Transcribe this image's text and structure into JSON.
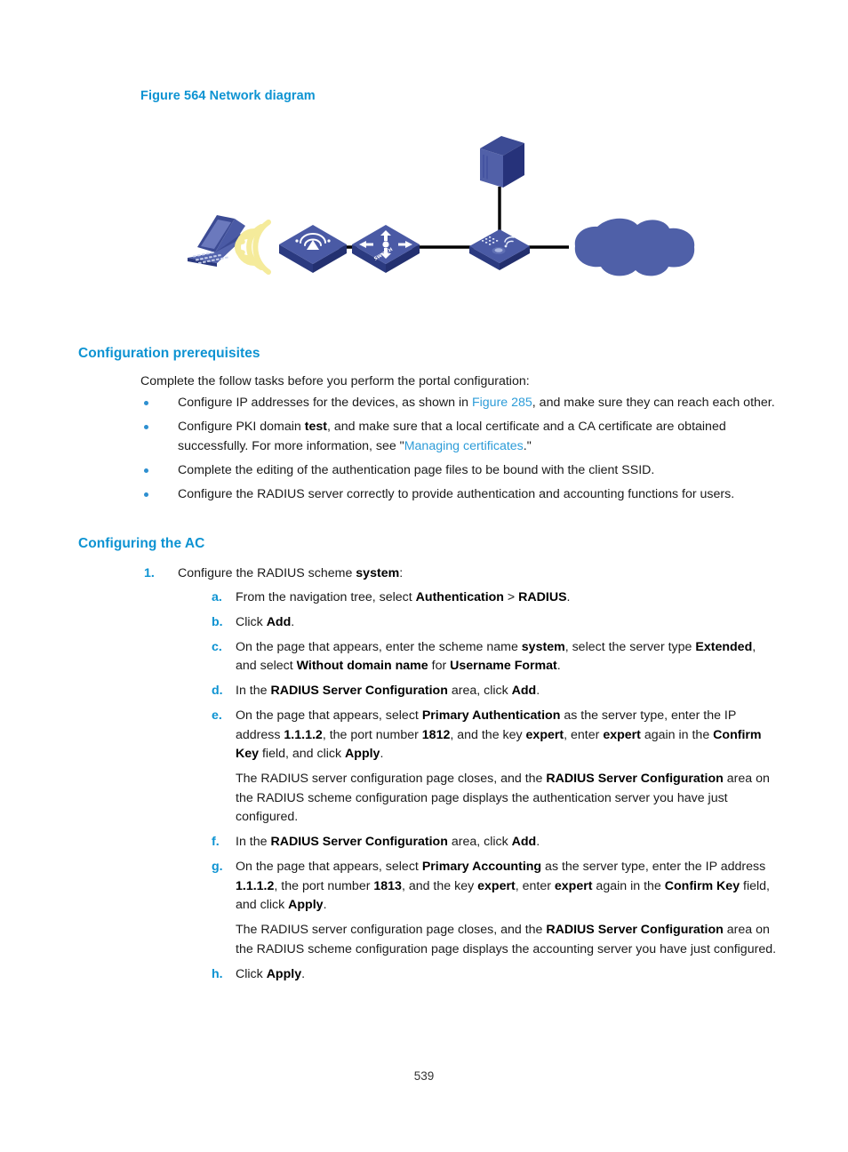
{
  "figure": {
    "caption": "Figure 564 Network diagram",
    "nodes": [
      {
        "id": "client",
        "icon": "laptop-icon",
        "label": ""
      },
      {
        "id": "wireless-signal",
        "icon": "wireless-waves-icon",
        "label": ""
      },
      {
        "id": "ap",
        "icon": "access-point-icon",
        "label": ""
      },
      {
        "id": "switch",
        "icon": "switch-icon",
        "label": "SWITCH"
      },
      {
        "id": "ac",
        "icon": "access-controller-icon",
        "label": ""
      },
      {
        "id": "server",
        "icon": "server-icon",
        "label": ""
      },
      {
        "id": "network-cloud",
        "icon": "cloud-icon",
        "label": ""
      }
    ],
    "colors": {
      "device_dark": "#2b3a80",
      "device_mid": "#3d4f96",
      "device_light": "#5b6cb0",
      "cloud": "#4f60a8",
      "signal": "#f5ea9a",
      "link": "#000000",
      "laptop_screen": "#6b79bd"
    }
  },
  "sections": {
    "prerequisites": {
      "heading": "Configuration prerequisites",
      "intro": "Complete the follow tasks before you perform the portal configuration:",
      "bullets": [
        {
          "parts": [
            {
              "t": "Configure IP addresses for the devices, as shown in ",
              "s": "normal"
            },
            {
              "t": "Figure 285",
              "s": "link"
            },
            {
              "t": ", and make sure they can reach each other.",
              "s": "normal"
            }
          ]
        },
        {
          "parts": [
            {
              "t": "Configure PKI domain ",
              "s": "normal"
            },
            {
              "t": "test",
              "s": "bold"
            },
            {
              "t": ", and make sure that a local certificate and a CA certificate are obtained successfully. For more information, see \"",
              "s": "normal"
            },
            {
              "t": "Managing certificates",
              "s": "link"
            },
            {
              "t": ".\"",
              "s": "normal"
            }
          ]
        },
        {
          "parts": [
            {
              "t": "Complete the editing of the authentication page files to be bound with the client SSID.",
              "s": "normal"
            }
          ]
        },
        {
          "parts": [
            {
              "t": "Configure the RADIUS server correctly to provide authentication and accounting functions for users.",
              "s": "normal"
            }
          ]
        }
      ]
    },
    "configuring_ac": {
      "heading": "Configuring the AC",
      "steps": [
        {
          "marker": "1.",
          "parts": [
            {
              "t": "Configure the RADIUS scheme ",
              "s": "normal"
            },
            {
              "t": "system",
              "s": "bold"
            },
            {
              "t": ":",
              "s": "normal"
            }
          ],
          "substeps": [
            {
              "marker": "a.",
              "parts": [
                {
                  "t": "From the navigation tree, select ",
                  "s": "normal"
                },
                {
                  "t": "Authentication",
                  "s": "bold"
                },
                {
                  "t": " > ",
                  "s": "normal"
                },
                {
                  "t": "RADIUS",
                  "s": "bold"
                },
                {
                  "t": ".",
                  "s": "normal"
                }
              ]
            },
            {
              "marker": "b.",
              "parts": [
                {
                  "t": "Click ",
                  "s": "normal"
                },
                {
                  "t": "Add",
                  "s": "bold"
                },
                {
                  "t": ".",
                  "s": "normal"
                }
              ]
            },
            {
              "marker": "c.",
              "parts": [
                {
                  "t": "On the page that appears, enter the scheme name ",
                  "s": "normal"
                },
                {
                  "t": "system",
                  "s": "bold"
                },
                {
                  "t": ", select the server type ",
                  "s": "normal"
                },
                {
                  "t": "Extended",
                  "s": "bold"
                },
                {
                  "t": ", and select ",
                  "s": "normal"
                },
                {
                  "t": "Without domain name",
                  "s": "bold"
                },
                {
                  "t": " for ",
                  "s": "normal"
                },
                {
                  "t": "Username Format",
                  "s": "bold"
                },
                {
                  "t": ".",
                  "s": "normal"
                }
              ]
            },
            {
              "marker": "d.",
              "parts": [
                {
                  "t": "In the ",
                  "s": "normal"
                },
                {
                  "t": "RADIUS Server Configuration",
                  "s": "bold"
                },
                {
                  "t": " area, click ",
                  "s": "normal"
                },
                {
                  "t": "Add",
                  "s": "bold"
                },
                {
                  "t": ".",
                  "s": "normal"
                }
              ]
            },
            {
              "marker": "e.",
              "parts": [
                {
                  "t": "On the page that appears, select ",
                  "s": "normal"
                },
                {
                  "t": "Primary Authentication",
                  "s": "bold"
                },
                {
                  "t": " as the server type, enter the IP address ",
                  "s": "normal"
                },
                {
                  "t": "1.1.1.2",
                  "s": "bold"
                },
                {
                  "t": ", the port number ",
                  "s": "normal"
                },
                {
                  "t": "1812",
                  "s": "bold"
                },
                {
                  "t": ", and the key ",
                  "s": "normal"
                },
                {
                  "t": "expert",
                  "s": "bold"
                },
                {
                  "t": ", enter ",
                  "s": "normal"
                },
                {
                  "t": "expert",
                  "s": "bold"
                },
                {
                  "t": " again in the ",
                  "s": "normal"
                },
                {
                  "t": "Confirm Key",
                  "s": "bold"
                },
                {
                  "t": " field, and click ",
                  "s": "normal"
                },
                {
                  "t": "Apply",
                  "s": "bold"
                },
                {
                  "t": ".",
                  "s": "normal"
                }
              ],
              "note": [
                {
                  "t": "The RADIUS server configuration page closes, and the ",
                  "s": "normal"
                },
                {
                  "t": "RADIUS Server Configuration",
                  "s": "bold"
                },
                {
                  "t": " area on the RADIUS scheme configuration page displays the authentication server you have just configured.",
                  "s": "normal"
                }
              ]
            },
            {
              "marker": "f.",
              "parts": [
                {
                  "t": "In the ",
                  "s": "normal"
                },
                {
                  "t": "RADIUS Server Configuration",
                  "s": "bold"
                },
                {
                  "t": " area, click ",
                  "s": "normal"
                },
                {
                  "t": "Add",
                  "s": "bold"
                },
                {
                  "t": ".",
                  "s": "normal"
                }
              ]
            },
            {
              "marker": "g.",
              "parts": [
                {
                  "t": "On the page that appears, select ",
                  "s": "normal"
                },
                {
                  "t": "Primary Accounting",
                  "s": "bold"
                },
                {
                  "t": " as the server type, enter the IP address ",
                  "s": "normal"
                },
                {
                  "t": "1.1.1.2",
                  "s": "bold"
                },
                {
                  "t": ", the port number ",
                  "s": "normal"
                },
                {
                  "t": "1813",
                  "s": "bold"
                },
                {
                  "t": ", and the key ",
                  "s": "normal"
                },
                {
                  "t": "expert",
                  "s": "bold"
                },
                {
                  "t": ", enter ",
                  "s": "normal"
                },
                {
                  "t": "expert",
                  "s": "bold"
                },
                {
                  "t": " again in the ",
                  "s": "normal"
                },
                {
                  "t": "Confirm Key",
                  "s": "bold"
                },
                {
                  "t": " field, and click ",
                  "s": "normal"
                },
                {
                  "t": "Apply",
                  "s": "bold"
                },
                {
                  "t": ".",
                  "s": "normal"
                }
              ],
              "note": [
                {
                  "t": "The RADIUS server configuration page closes, and the ",
                  "s": "normal"
                },
                {
                  "t": "RADIUS Server Configuration",
                  "s": "bold"
                },
                {
                  "t": " area on the RADIUS scheme configuration page displays the accounting server you have just configured.",
                  "s": "normal"
                }
              ]
            },
            {
              "marker": "h.",
              "parts": [
                {
                  "t": "Click ",
                  "s": "normal"
                },
                {
                  "t": "Apply",
                  "s": "bold"
                },
                {
                  "t": ".",
                  "s": "normal"
                }
              ]
            }
          ]
        }
      ]
    }
  },
  "footer": {
    "page_number": "539"
  }
}
